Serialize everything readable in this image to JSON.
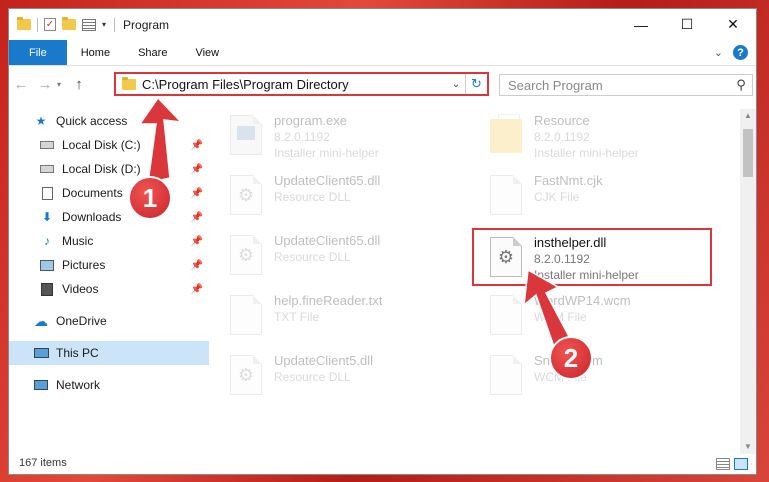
{
  "window": {
    "title": "Program",
    "controls": {
      "minimize": "—",
      "maximize": "☐",
      "close": "✕"
    }
  },
  "quick_access_toolbar": {
    "dropdown": "▾"
  },
  "ribbon": {
    "tabs": [
      "File",
      "Home",
      "Share",
      "View"
    ],
    "help": "?"
  },
  "nav": {
    "back": "←",
    "forward": "→",
    "recent": "▾",
    "up": "↑"
  },
  "address": {
    "path": "C:\\Program Files\\Program Directory",
    "dropdown": "⌄",
    "refresh": "↻"
  },
  "search": {
    "placeholder": "Search Program"
  },
  "sidebar": {
    "items": [
      {
        "label": "Quick access",
        "icon": "star-icon",
        "pinned": false
      },
      {
        "label": "Local Disk (C:)",
        "icon": "drive-icon",
        "pinned": true
      },
      {
        "label": "Local Disk (D:)",
        "icon": "drive-icon",
        "pinned": true
      },
      {
        "label": "Documents",
        "icon": "documents-icon",
        "pinned": true
      },
      {
        "label": "Downloads",
        "icon": "download-icon",
        "pinned": true
      },
      {
        "label": "Music",
        "icon": "music-icon",
        "pinned": true
      },
      {
        "label": "Pictures",
        "icon": "pictures-icon",
        "pinned": true
      },
      {
        "label": "Videos",
        "icon": "videos-icon",
        "pinned": true
      },
      {
        "label": "OneDrive",
        "icon": "cloud-icon"
      },
      {
        "label": "This PC",
        "icon": "computer-icon",
        "selected": true
      },
      {
        "label": "Network",
        "icon": "network-icon"
      }
    ]
  },
  "files": [
    {
      "name": "program.exe",
      "line2": "8.2.0.1192",
      "line3": "Installer mini-helper",
      "faded": true
    },
    {
      "name": "Resource",
      "line2": "8.2.0.1192",
      "line3": "Installer mini-helper",
      "faded": true
    },
    {
      "name": "UpdateClient65.dll",
      "line2": "Resource DLL",
      "line3": "",
      "faded": true
    },
    {
      "name": "FastNmt.cjk",
      "line2": "CJK File",
      "line3": "",
      "faded": true
    },
    {
      "name": "UpdateClient65.dll",
      "line2": "Resource DLL",
      "line3": "",
      "faded": true
    },
    {
      "name": "insthelper.dll",
      "line2": "8.2.0.1192",
      "line3": "Installer mini-helper",
      "faded": false
    },
    {
      "name": "help.fineReader.txt",
      "line2": "TXT File",
      "line3": "",
      "faded": true
    },
    {
      "name": "WordWP14.wcm",
      "line2": "WCM File",
      "line3": "",
      "faded": true
    },
    {
      "name": "UpdateClient5.dll",
      "line2": "Resource DLL",
      "line3": "",
      "faded": true
    },
    {
      "name": "SndTrf.wcm",
      "line2": "WCM File",
      "line3": "",
      "faded": true
    }
  ],
  "status": {
    "items_count": "167 items"
  },
  "annotations": {
    "step1": "1",
    "step2": "2",
    "color": "#d9373b"
  }
}
